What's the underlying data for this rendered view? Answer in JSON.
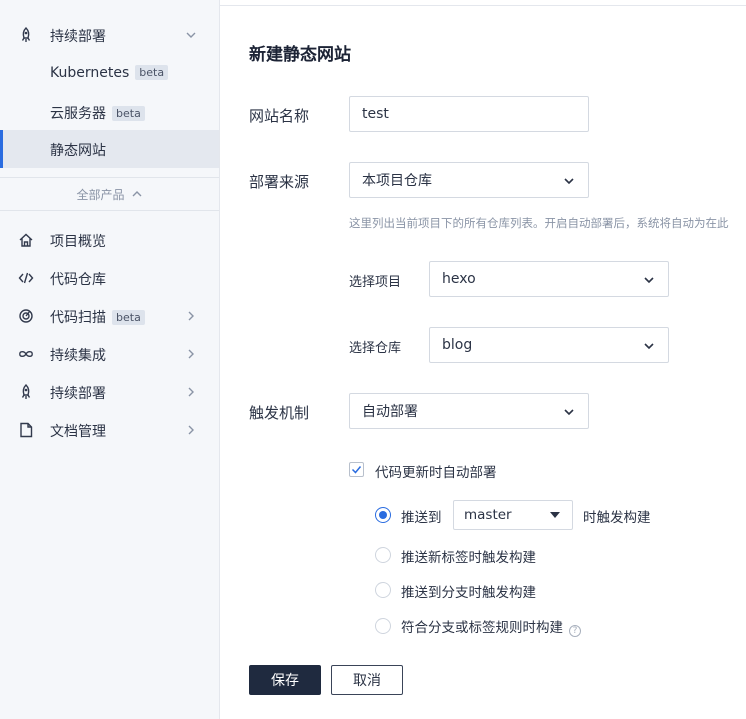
{
  "sidebar": {
    "group_deploy": {
      "label": "持续部署",
      "icon": "rocket-icon",
      "expanded": true
    },
    "sub_items": [
      {
        "label": "Kubernetes",
        "badge": "beta"
      },
      {
        "label": "云服务器",
        "badge": "beta"
      },
      {
        "label": "静态网站",
        "badge": "",
        "active": true
      }
    ],
    "all_products": "全部产品",
    "items": [
      {
        "label": "项目概览",
        "icon": "home-icon"
      },
      {
        "label": "代码仓库",
        "icon": "code-icon"
      },
      {
        "label": "代码扫描",
        "icon": "target-icon",
        "badge": "beta"
      },
      {
        "label": "持续集成",
        "icon": "infinity-icon"
      },
      {
        "label": "持续部署",
        "icon": "rocket-icon"
      },
      {
        "label": "文档管理",
        "icon": "document-icon"
      }
    ]
  },
  "form": {
    "title": "新建静态网站",
    "site_name_label": "网站名称",
    "site_name_value": "test",
    "source_label": "部署来源",
    "source_value": "本项目仓库",
    "hint": "这里列出当前项目下的所有仓库列表。开启自动部署后，系统将自动为在此",
    "project_label": "选择项目",
    "project_value": "hexo",
    "repo_label": "选择仓库",
    "repo_value": "blog",
    "trigger_label": "触发机制",
    "trigger_value": "自动部署",
    "auto_deploy_checkbox": "代码更新时自动部署",
    "auto_deploy_checked": true,
    "radio_push_to": "推送到",
    "branch_value": "master",
    "radio_push_suffix": "时触发构建",
    "radio_tag": "推送新标签时触发构建",
    "radio_branch": "推送到分支时触发构建",
    "radio_rule": "符合分支或标签规则时构建",
    "selected_radio": "push_to"
  },
  "buttons": {
    "save": "保存",
    "cancel": "取消"
  },
  "colors": {
    "accent": "#2a6ce0",
    "primary_button": "#1f2a3f",
    "sidebar_bg": "#f5f7fa"
  }
}
